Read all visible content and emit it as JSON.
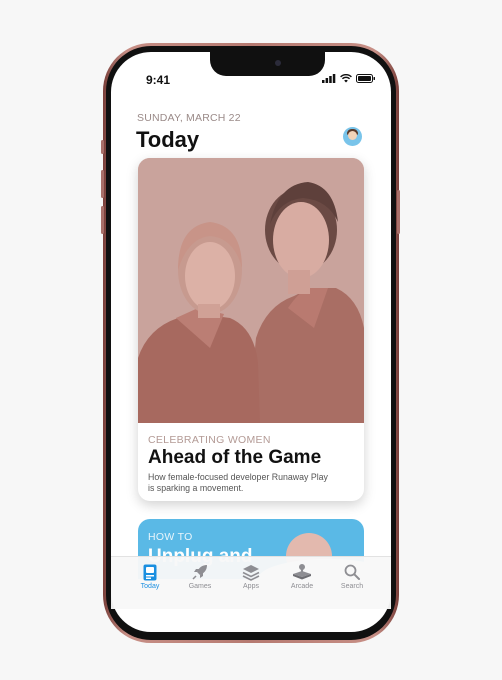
{
  "status": {
    "time": "9:41"
  },
  "header": {
    "date": "SUNDAY, MARCH 22",
    "title": "Today"
  },
  "featured": {
    "eyebrow": "CELEBRATING WOMEN",
    "title": "Ahead of the Game",
    "subtitle": "How female-focused developer Runaway Play is sparking a movement."
  },
  "secondary": {
    "eyebrow": "HOW TO",
    "title": "Unplug and"
  },
  "tabs": [
    {
      "label": "Today",
      "icon": "today-icon"
    },
    {
      "label": "Games",
      "icon": "rocket-icon"
    },
    {
      "label": "Apps",
      "icon": "layers-icon"
    },
    {
      "label": "Arcade",
      "icon": "arcade-icon"
    },
    {
      "label": "Search",
      "icon": "search-icon"
    }
  ],
  "colors": {
    "accent": "#1a8fe0",
    "card2": "#5ab9e6",
    "phone": "#b67a71"
  }
}
